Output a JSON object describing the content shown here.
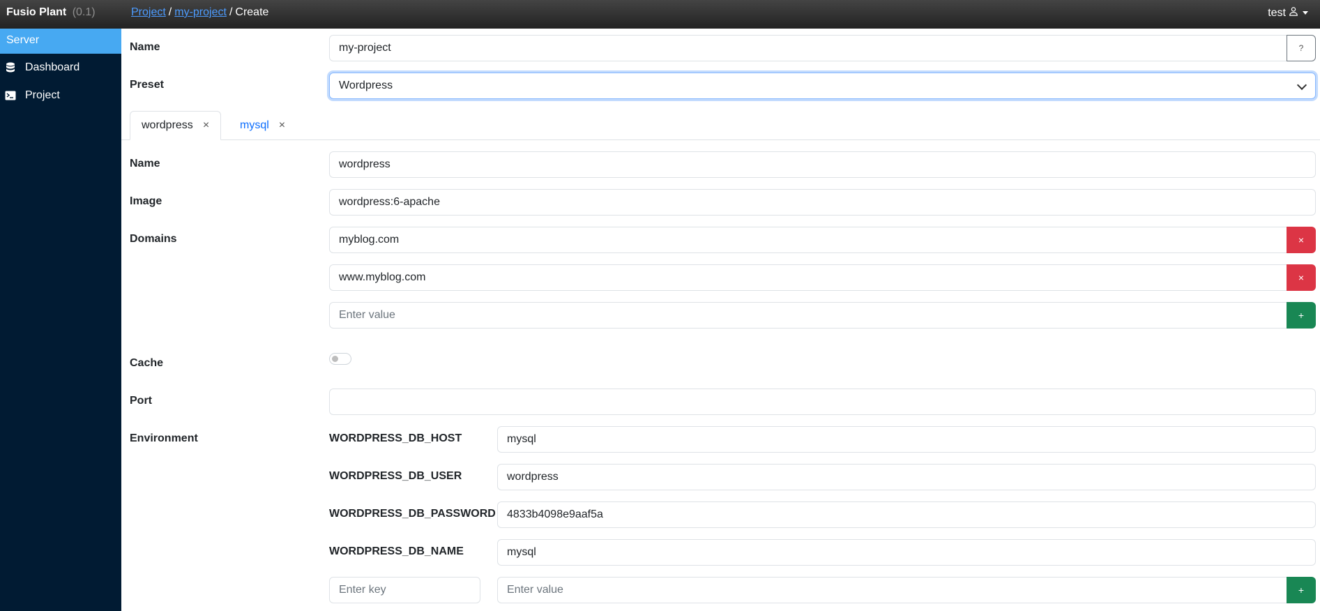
{
  "app": {
    "title": "Fusio Plant",
    "version": "(0.1)"
  },
  "breadcrumb": {
    "items": [
      "Project",
      "my-project"
    ],
    "current": "Create",
    "separator": "/"
  },
  "user": {
    "name": "test"
  },
  "sidebar": {
    "header": "Server",
    "items": [
      {
        "label": "Dashboard",
        "icon": "database-icon"
      },
      {
        "label": "Project",
        "icon": "terminal-icon"
      }
    ]
  },
  "form": {
    "name_label": "Name",
    "name_value": "my-project",
    "help_label": "?",
    "preset_label": "Preset",
    "preset_value": "Wordpress"
  },
  "tabs": [
    {
      "label": "wordpress",
      "close": "×",
      "active": true
    },
    {
      "label": "mysql",
      "close": "×",
      "active": false
    }
  ],
  "service": {
    "name_label": "Name",
    "name_value": "wordpress",
    "image_label": "Image",
    "image_value": "wordpress:6-apache",
    "domains_label": "Domains",
    "domains": [
      "myblog.com",
      "www.myblog.com"
    ],
    "domain_placeholder": "Enter value",
    "cache_label": "Cache",
    "cache_enabled": false,
    "port_label": "Port",
    "port_value": "",
    "environment_label": "Environment",
    "environment": [
      {
        "key": "WORDPRESS_DB_HOST",
        "value": "mysql"
      },
      {
        "key": "WORDPRESS_DB_USER",
        "value": "wordpress"
      },
      {
        "key": "WORDPRESS_DB_PASSWORD",
        "value": "4833b4098e9aaf5a"
      },
      {
        "key": "WORDPRESS_DB_NAME",
        "value": "mysql"
      }
    ],
    "env_key_placeholder": "Enter key",
    "env_value_placeholder": "Enter value"
  },
  "buttons": {
    "remove": "×",
    "add": "+"
  },
  "colors": {
    "topbar": "#333333",
    "sidebar": "#011b33",
    "sidebar_active": "#47a9f2",
    "danger": "#dc3545",
    "success": "#198754",
    "link": "#0d6efd"
  }
}
